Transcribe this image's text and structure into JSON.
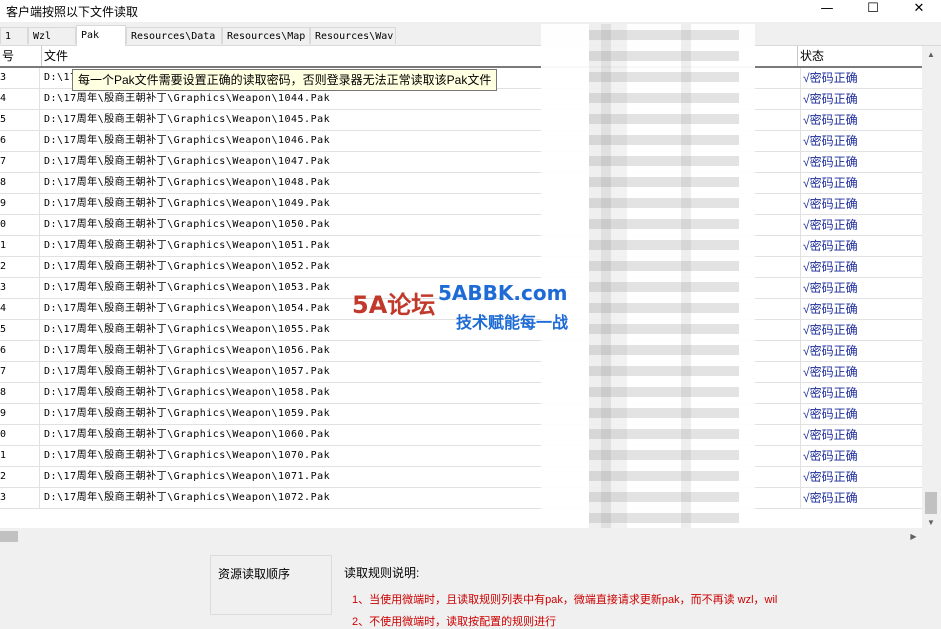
{
  "window": {
    "title": "客户端按照以下文件读取",
    "controls": {
      "minimize": "—",
      "maximize": "☐",
      "close": "✕"
    }
  },
  "tabs": [
    {
      "label": "1"
    },
    {
      "label": "Wzl"
    },
    {
      "label": "Pak"
    },
    {
      "label": "Resources\\Data"
    },
    {
      "label": "Resources\\Map"
    },
    {
      "label": "Resources\\Wav"
    }
  ],
  "active_tab": "Pak",
  "grid": {
    "headers": {
      "no": "号",
      "file": "文件",
      "status": "状态"
    },
    "rows": [
      {
        "no": "3",
        "file": "D:\\17周年\\殷商王朝补丁\\Graphics\\Weapon\\1043.Pak",
        "status": "√密码正确"
      },
      {
        "no": "4",
        "file": "D:\\17周年\\殷商王朝补丁\\Graphics\\Weapon\\1044.Pak",
        "status": "√密码正确"
      },
      {
        "no": "5",
        "file": "D:\\17周年\\殷商王朝补丁\\Graphics\\Weapon\\1045.Pak",
        "status": "√密码正确"
      },
      {
        "no": "6",
        "file": "D:\\17周年\\殷商王朝补丁\\Graphics\\Weapon\\1046.Pak",
        "status": "√密码正确"
      },
      {
        "no": "7",
        "file": "D:\\17周年\\殷商王朝补丁\\Graphics\\Weapon\\1047.Pak",
        "status": "√密码正确"
      },
      {
        "no": "8",
        "file": "D:\\17周年\\殷商王朝补丁\\Graphics\\Weapon\\1048.Pak",
        "status": "√密码正确"
      },
      {
        "no": "9",
        "file": "D:\\17周年\\殷商王朝补丁\\Graphics\\Weapon\\1049.Pak",
        "status": "√密码正确"
      },
      {
        "no": "0",
        "file": "D:\\17周年\\殷商王朝补丁\\Graphics\\Weapon\\1050.Pak",
        "status": "√密码正确"
      },
      {
        "no": "1",
        "file": "D:\\17周年\\殷商王朝补丁\\Graphics\\Weapon\\1051.Pak",
        "status": "√密码正确"
      },
      {
        "no": "2",
        "file": "D:\\17周年\\殷商王朝补丁\\Graphics\\Weapon\\1052.Pak",
        "status": "√密码正确"
      },
      {
        "no": "3",
        "file": "D:\\17周年\\殷商王朝补丁\\Graphics\\Weapon\\1053.Pak",
        "status": "√密码正确"
      },
      {
        "no": "4",
        "file": "D:\\17周年\\殷商王朝补丁\\Graphics\\Weapon\\1054.Pak",
        "status": "√密码正确"
      },
      {
        "no": "5",
        "file": "D:\\17周年\\殷商王朝补丁\\Graphics\\Weapon\\1055.Pak",
        "status": "√密码正确"
      },
      {
        "no": "6",
        "file": "D:\\17周年\\殷商王朝补丁\\Graphics\\Weapon\\1056.Pak",
        "status": "√密码正确"
      },
      {
        "no": "7",
        "file": "D:\\17周年\\殷商王朝补丁\\Graphics\\Weapon\\1057.Pak",
        "status": "√密码正确"
      },
      {
        "no": "8",
        "file": "D:\\17周年\\殷商王朝补丁\\Graphics\\Weapon\\1058.Pak",
        "status": "√密码正确"
      },
      {
        "no": "9",
        "file": "D:\\17周年\\殷商王朝补丁\\Graphics\\Weapon\\1059.Pak",
        "status": "√密码正确"
      },
      {
        "no": "0",
        "file": "D:\\17周年\\殷商王朝补丁\\Graphics\\Weapon\\1060.Pak",
        "status": "√密码正确"
      },
      {
        "no": "1",
        "file": "D:\\17周年\\殷商王朝补丁\\Graphics\\Weapon\\1070.Pak",
        "status": "√密码正确"
      },
      {
        "no": "2",
        "file": "D:\\17周年\\殷商王朝补丁\\Graphics\\Weapon\\1071.Pak",
        "status": "√密码正确"
      },
      {
        "no": "3",
        "file": "D:\\17周年\\殷商王朝补丁\\Graphics\\Weapon\\1072.Pak",
        "status": "√密码正确"
      }
    ]
  },
  "tooltip": "每一个Pak文件需要设置正确的读取密码，否则登录器无法正常读取该Pak文件",
  "bottom": {
    "order_label": "资源读取顺序",
    "rules_label": "读取规则说明:",
    "rules": [
      "1、当使用微端时，且读取规则列表中有pak，微端直接请求更新pak，而不再读 wzl，wil",
      "2、不使用微端时，读取按配置的规则进行"
    ]
  },
  "watermark": {
    "logo": "5A论坛",
    "site": "5ABBK.com",
    "slogan": "技术赋能每一战"
  },
  "colors": {
    "status_text": "#1a2a9a",
    "rules_text": "#cc0000",
    "tooltip_bg": "#ffffe1"
  }
}
